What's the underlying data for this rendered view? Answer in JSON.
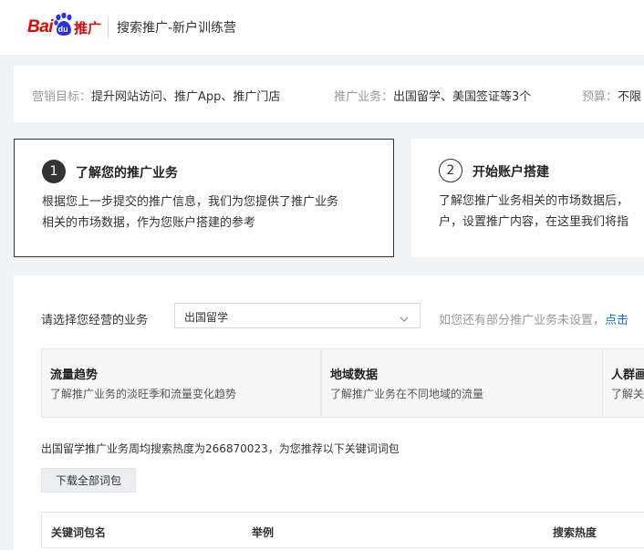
{
  "header": {
    "logo": {
      "bai": "Bai",
      "du": "du",
      "tuiguang": "推广"
    },
    "title": "搜索推广-新户训练营"
  },
  "summary": {
    "goal_label": "营销目标：",
    "goal_value": "提升网站访问、推广App、推广门店",
    "business_label": "推广业务：",
    "business_value": "出国留学、美国签证等3个",
    "budget_label": "预算：",
    "budget_value": "不限"
  },
  "steps": [
    {
      "number": "1",
      "title": "了解您的推广业务",
      "desc_line1": "根据您上一步提交的推广信息，我们为您提供了推广业务",
      "desc_line2": "相关的市场数据，作为您账户搭建的参考"
    },
    {
      "number": "2",
      "title": "开始账户搭建",
      "desc_line1": "了解您推广业务相关的市场数据后，",
      "desc_line2": "户，设置推广内容，在这里我们将指"
    }
  ],
  "business_select": {
    "label": "请选择您经营的业务",
    "value": "出国留学",
    "hint": "如您还有部分推广业务未设置，",
    "hint_link": "点击"
  },
  "tabs": [
    {
      "title": "流量趋势",
      "desc": "了解推广业务的淡旺季和流量变化趋势"
    },
    {
      "title": "地域数据",
      "desc": "了解推广业务在不同地域的流量"
    },
    {
      "title": "人群画",
      "desc": "了解关"
    }
  ],
  "heat_info": "出国留学推广业务周均搜索热度为266870023，为您推荐以下关键词词包",
  "download_button": "下载全部词包",
  "table": {
    "columns": [
      "关键词包名",
      "举例",
      "搜索热度"
    ]
  }
}
